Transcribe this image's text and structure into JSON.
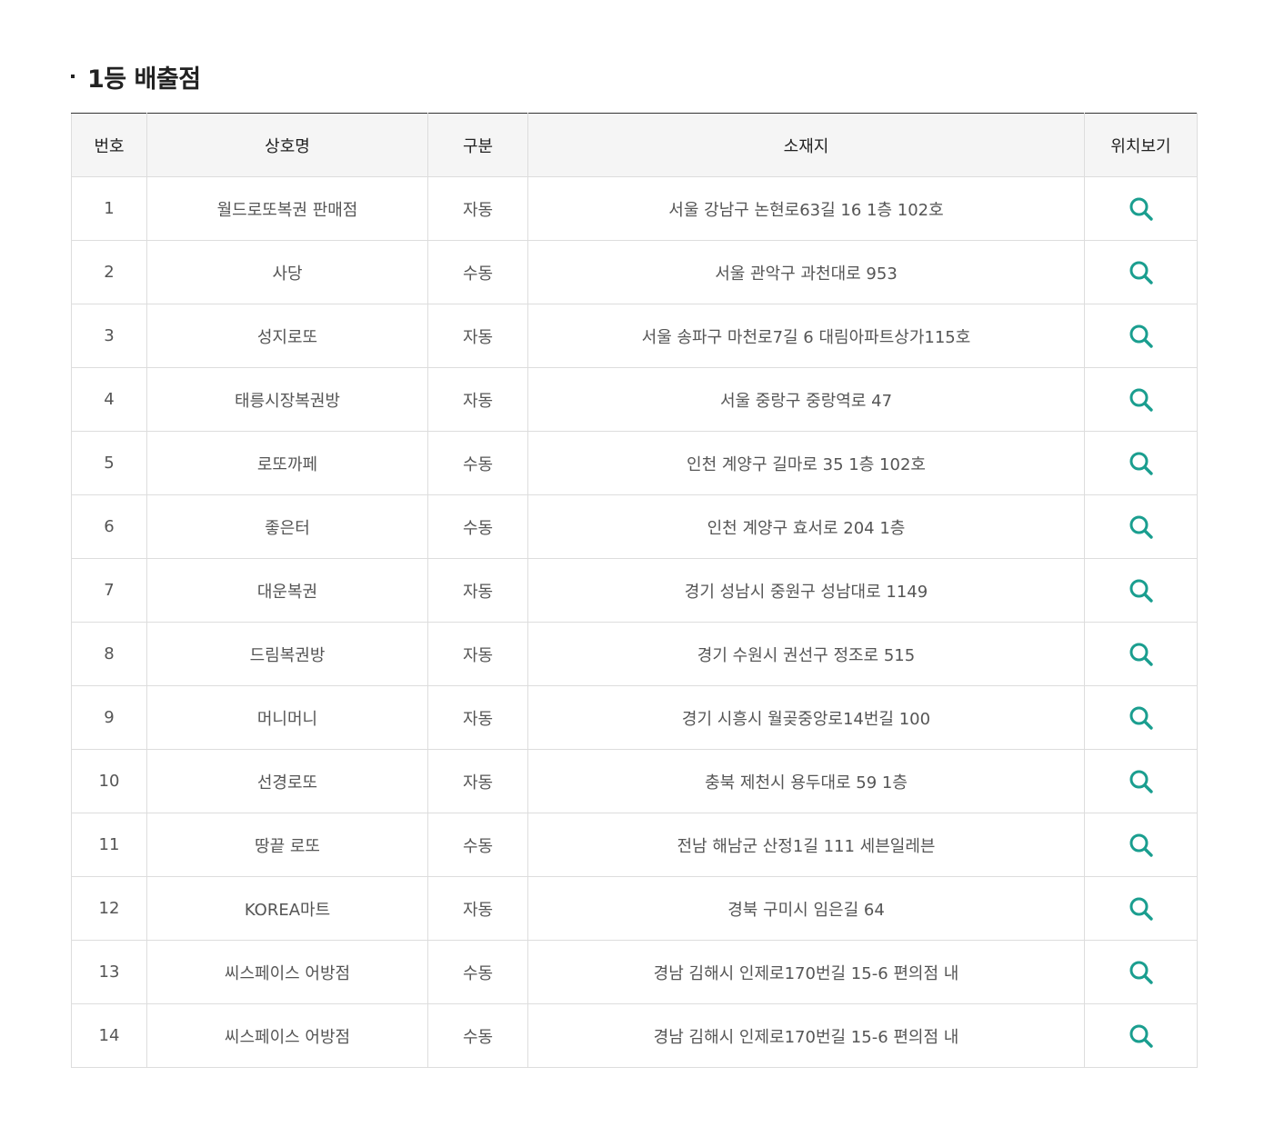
{
  "section": {
    "title": "1등 배출점"
  },
  "table": {
    "headers": {
      "no": "번호",
      "name": "상호명",
      "type": "구분",
      "address": "소재지",
      "map": "위치보기"
    },
    "rows": [
      {
        "no": "1",
        "name": "월드로또복권 판매점",
        "type": "자동",
        "address": "서울 강남구 논현로63길 16 1층 102호"
      },
      {
        "no": "2",
        "name": "사당",
        "type": "수동",
        "address": "서울 관악구 과천대로 953"
      },
      {
        "no": "3",
        "name": "성지로또",
        "type": "자동",
        "address": "서울 송파구 마천로7길 6 대림아파트상가115호"
      },
      {
        "no": "4",
        "name": "태릉시장복권방",
        "type": "자동",
        "address": "서울 중랑구 중랑역로 47"
      },
      {
        "no": "5",
        "name": "로또까페",
        "type": "수동",
        "address": "인천 계양구 길마로 35 1층 102호"
      },
      {
        "no": "6",
        "name": "좋은터",
        "type": "수동",
        "address": "인천 계양구 효서로 204 1층"
      },
      {
        "no": "7",
        "name": "대운복권",
        "type": "자동",
        "address": "경기 성남시 중원구 성남대로 1149"
      },
      {
        "no": "8",
        "name": "드림복권방",
        "type": "자동",
        "address": "경기 수원시 권선구 정조로 515"
      },
      {
        "no": "9",
        "name": "머니머니",
        "type": "자동",
        "address": "경기 시흥시 월곶중앙로14번길 100"
      },
      {
        "no": "10",
        "name": "선경로또",
        "type": "자동",
        "address": "충북 제천시 용두대로 59 1층"
      },
      {
        "no": "11",
        "name": "땅끝 로또",
        "type": "수동",
        "address": "전남 해남군 산정1길 111 세븐일레븐"
      },
      {
        "no": "12",
        "name": "KOREA마트",
        "type": "자동",
        "address": "경북 구미시 임은길 64"
      },
      {
        "no": "13",
        "name": "씨스페이스 어방점",
        "type": "수동",
        "address": "경남 김해시 인제로170번길 15-6 편의점 내"
      },
      {
        "no": "14",
        "name": "씨스페이스 어방점",
        "type": "수동",
        "address": "경남 김해시 인제로170번길 15-6 편의점 내"
      }
    ],
    "map_icon": "search-icon",
    "map_icon_color": "#1a9e8f"
  }
}
